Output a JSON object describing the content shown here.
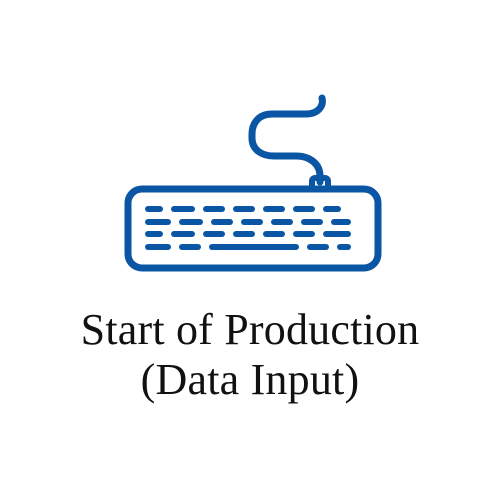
{
  "icon": {
    "name": "keyboard-icon",
    "color": "#0b56a4"
  },
  "caption": {
    "line1": "Start of Production",
    "line2": "(Data Input)"
  }
}
